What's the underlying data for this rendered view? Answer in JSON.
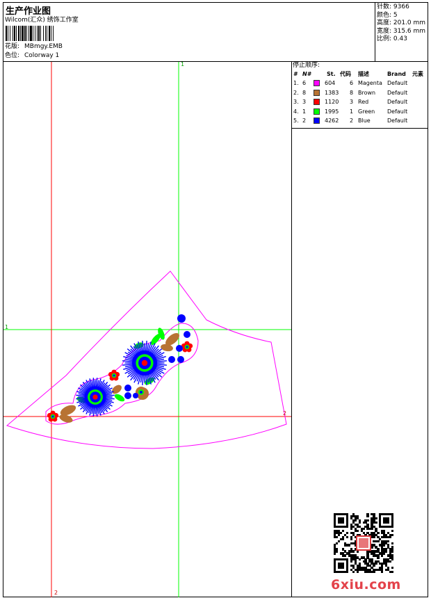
{
  "header": {
    "title": "生产作业图",
    "company": "Wilcom(汇众) 绣饰工作室",
    "design_label": "花版:",
    "design_value": "MBmgy.EMB",
    "colorway_label": "色位:",
    "colorway_value": "Colorway 1"
  },
  "stats": {
    "stitches": "针数: 9366",
    "colors": "颜色: 5",
    "height": "高度: 201.0 mm",
    "width": "宽度: 315.6 mm",
    "scale": "比例: 0.43"
  },
  "stop_sequence": {
    "title": "停止顺序:",
    "headers": {
      "num": "#",
      "needle": "N#",
      "st": "St.",
      "code": "代码",
      "desc": "描述",
      "brand": "Brand",
      "element": "元素"
    },
    "rows": [
      {
        "num": "1.",
        "needle": "6",
        "color": "#ff00ff",
        "st": "604",
        "code": "6",
        "desc": "Magenta",
        "brand": "Default"
      },
      {
        "num": "2.",
        "needle": "8",
        "color": "#b87333",
        "st": "1383",
        "code": "8",
        "desc": "Brown",
        "brand": "Default"
      },
      {
        "num": "3.",
        "needle": "3",
        "color": "#ff0000",
        "st": "1120",
        "code": "3",
        "desc": "Red",
        "brand": "Default"
      },
      {
        "num": "4.",
        "needle": "1",
        "color": "#00ff00",
        "st": "1995",
        "code": "1",
        "desc": "Green",
        "brand": "Default"
      },
      {
        "num": "5.",
        "needle": "2",
        "color": "#0000ff",
        "st": "4262",
        "code": "2",
        "desc": "Blue",
        "brand": "Default"
      }
    ]
  },
  "guides": {
    "vertical_green": "1",
    "horizontal_green": "1",
    "vertical_red": "2",
    "horizontal_red": "2"
  },
  "watermark": {
    "text": "6xiu.com"
  },
  "colors": {
    "outline": "#ff00ff",
    "guide_green": "#00ff00",
    "guide_red": "#ff0000",
    "blue": "#0000ff",
    "green": "#00ff00",
    "red": "#ff0000",
    "brown": "#b87333"
  }
}
